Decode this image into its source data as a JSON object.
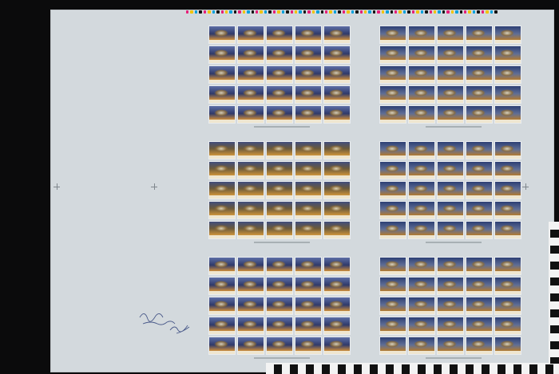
{
  "image": {
    "subject": "",
    "colors": {
      "background": "#0b0b0c",
      "sheet": "#d3d9dd",
      "stamp_blue": "#2f3a6b",
      "stamp_orange": "#c88a3c"
    },
    "panes": [
      {
        "name": "top-left",
        "variant": "a",
        "rows": 5,
        "cols": 5
      },
      {
        "name": "top-right",
        "variant": "c",
        "rows": 5,
        "cols": 5
      },
      {
        "name": "middle-left",
        "variant": "b",
        "rows": 5,
        "cols": 5
      },
      {
        "name": "middle-right",
        "variant": "c",
        "rows": 5,
        "cols": 5
      },
      {
        "name": "bottom-left",
        "variant": "a",
        "rows": 5,
        "cols": 5
      },
      {
        "name": "bottom-right",
        "variant": "c",
        "rows": 5,
        "cols": 5
      }
    ],
    "color_bar": [
      "#e61e78",
      "#f2c300",
      "#00a0dc",
      "#111111",
      "#e61e78",
      "#f2c300",
      "#00a0dc",
      "#111111"
    ],
    "icons": [
      "registration-mark-icon",
      "scale-bar-icon"
    ]
  }
}
